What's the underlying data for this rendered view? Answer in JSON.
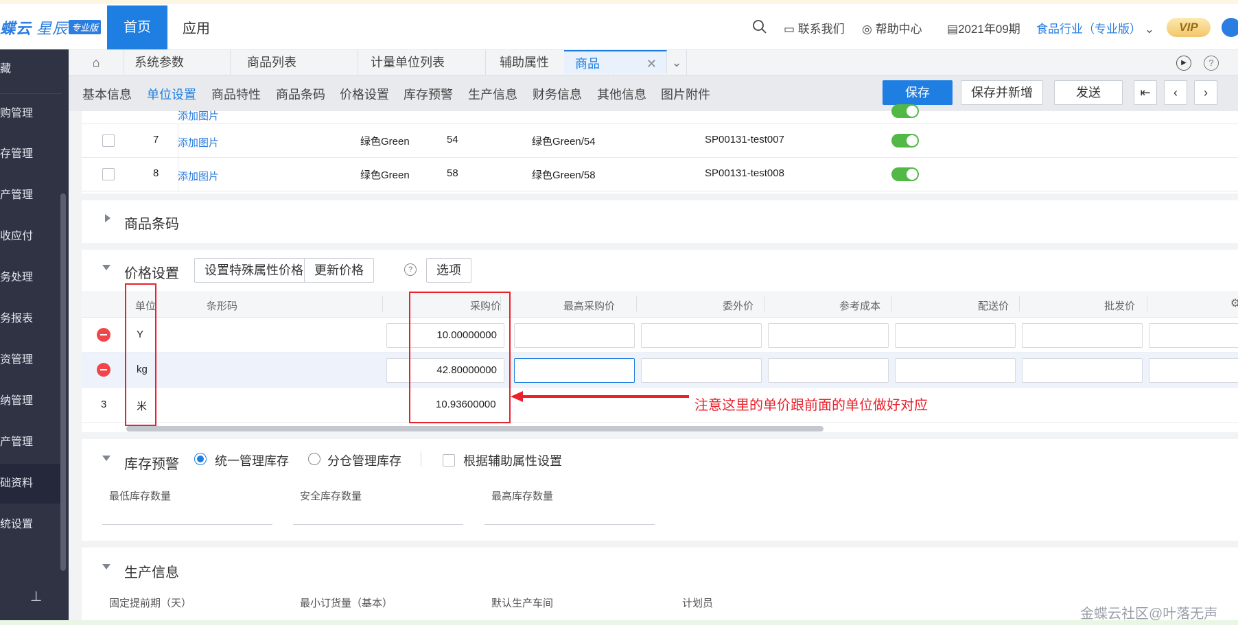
{
  "header": {
    "logo_text": "蝶云",
    "logo_text2": "星辰",
    "logo_badge": "专业版",
    "nav_home": "首页",
    "nav_app": "应用",
    "contact": "联系我们",
    "help": "帮助中心",
    "period": "2021年09期",
    "industry": "食品行业（专业版）",
    "vip": "VIP"
  },
  "sidebar": {
    "items": [
      "藏",
      "购管理",
      "存管理",
      "产管理",
      "收应付",
      "务处理",
      "务报表",
      "资管理",
      "纳管理",
      "产管理",
      "础资料",
      "统设置"
    ]
  },
  "tabs": [
    "系统参数",
    "商品列表",
    "计量单位列表",
    "辅助属性",
    "商品"
  ],
  "subnav": [
    "基本信息",
    "单位设置",
    "商品特性",
    "商品条码",
    "价格设置",
    "库存预警",
    "生产信息",
    "财务信息",
    "其他信息",
    "图片附件"
  ],
  "actions": {
    "save": "保存",
    "save_new": "保存并新增",
    "send": "发送"
  },
  "upper_rows": {
    "partial_link": "添加图片",
    "rows": [
      {
        "no": "7",
        "link": "添加图片",
        "color": "绿色Green",
        "size": "54",
        "combo": "绿色Green/54",
        "code": "SP00131-test007"
      },
      {
        "no": "8",
        "link": "添加图片",
        "color": "绿色Green",
        "size": "58",
        "combo": "绿色Green/58",
        "code": "SP00131-test008"
      }
    ]
  },
  "barcode_section": {
    "title": "商品条码"
  },
  "price_section": {
    "title": "价格设置",
    "btn_special": "设置特殊属性价格",
    "btn_update": "更新价格",
    "btn_options": "选项",
    "columns": [
      "单位",
      "条形码",
      "采购价",
      "最高采购价",
      "委外价",
      "参考成本",
      "配送价",
      "批发价"
    ],
    "rows": [
      {
        "no": "",
        "unit": "Y",
        "purchase": "10.00000000"
      },
      {
        "no": "",
        "unit": "kg",
        "purchase": "42.80000000"
      },
      {
        "no": "3",
        "unit": "米",
        "purchase": "10.93600000"
      }
    ],
    "annotation": "注意这里的单价跟前面的单位做好对应"
  },
  "stock_section": {
    "title": "库存预警",
    "radio_unified": "统一管理库存",
    "radio_split": "分仓管理库存",
    "check_aux": "根据辅助属性设置",
    "fields": [
      "最低库存数量",
      "安全库存数量",
      "最高库存数量"
    ]
  },
  "production_section": {
    "title": "生产信息",
    "fields": [
      "固定提前期（天）",
      "最小订货量（基本）",
      "默认生产车间",
      "计划员"
    ]
  },
  "watermark": "金蝶云社区@叶落无声",
  "colors": {
    "accent": "#1e7ee1",
    "sidebar": "#2f3344",
    "annotation": "#e9212b",
    "toggle_on": "#52b947"
  }
}
